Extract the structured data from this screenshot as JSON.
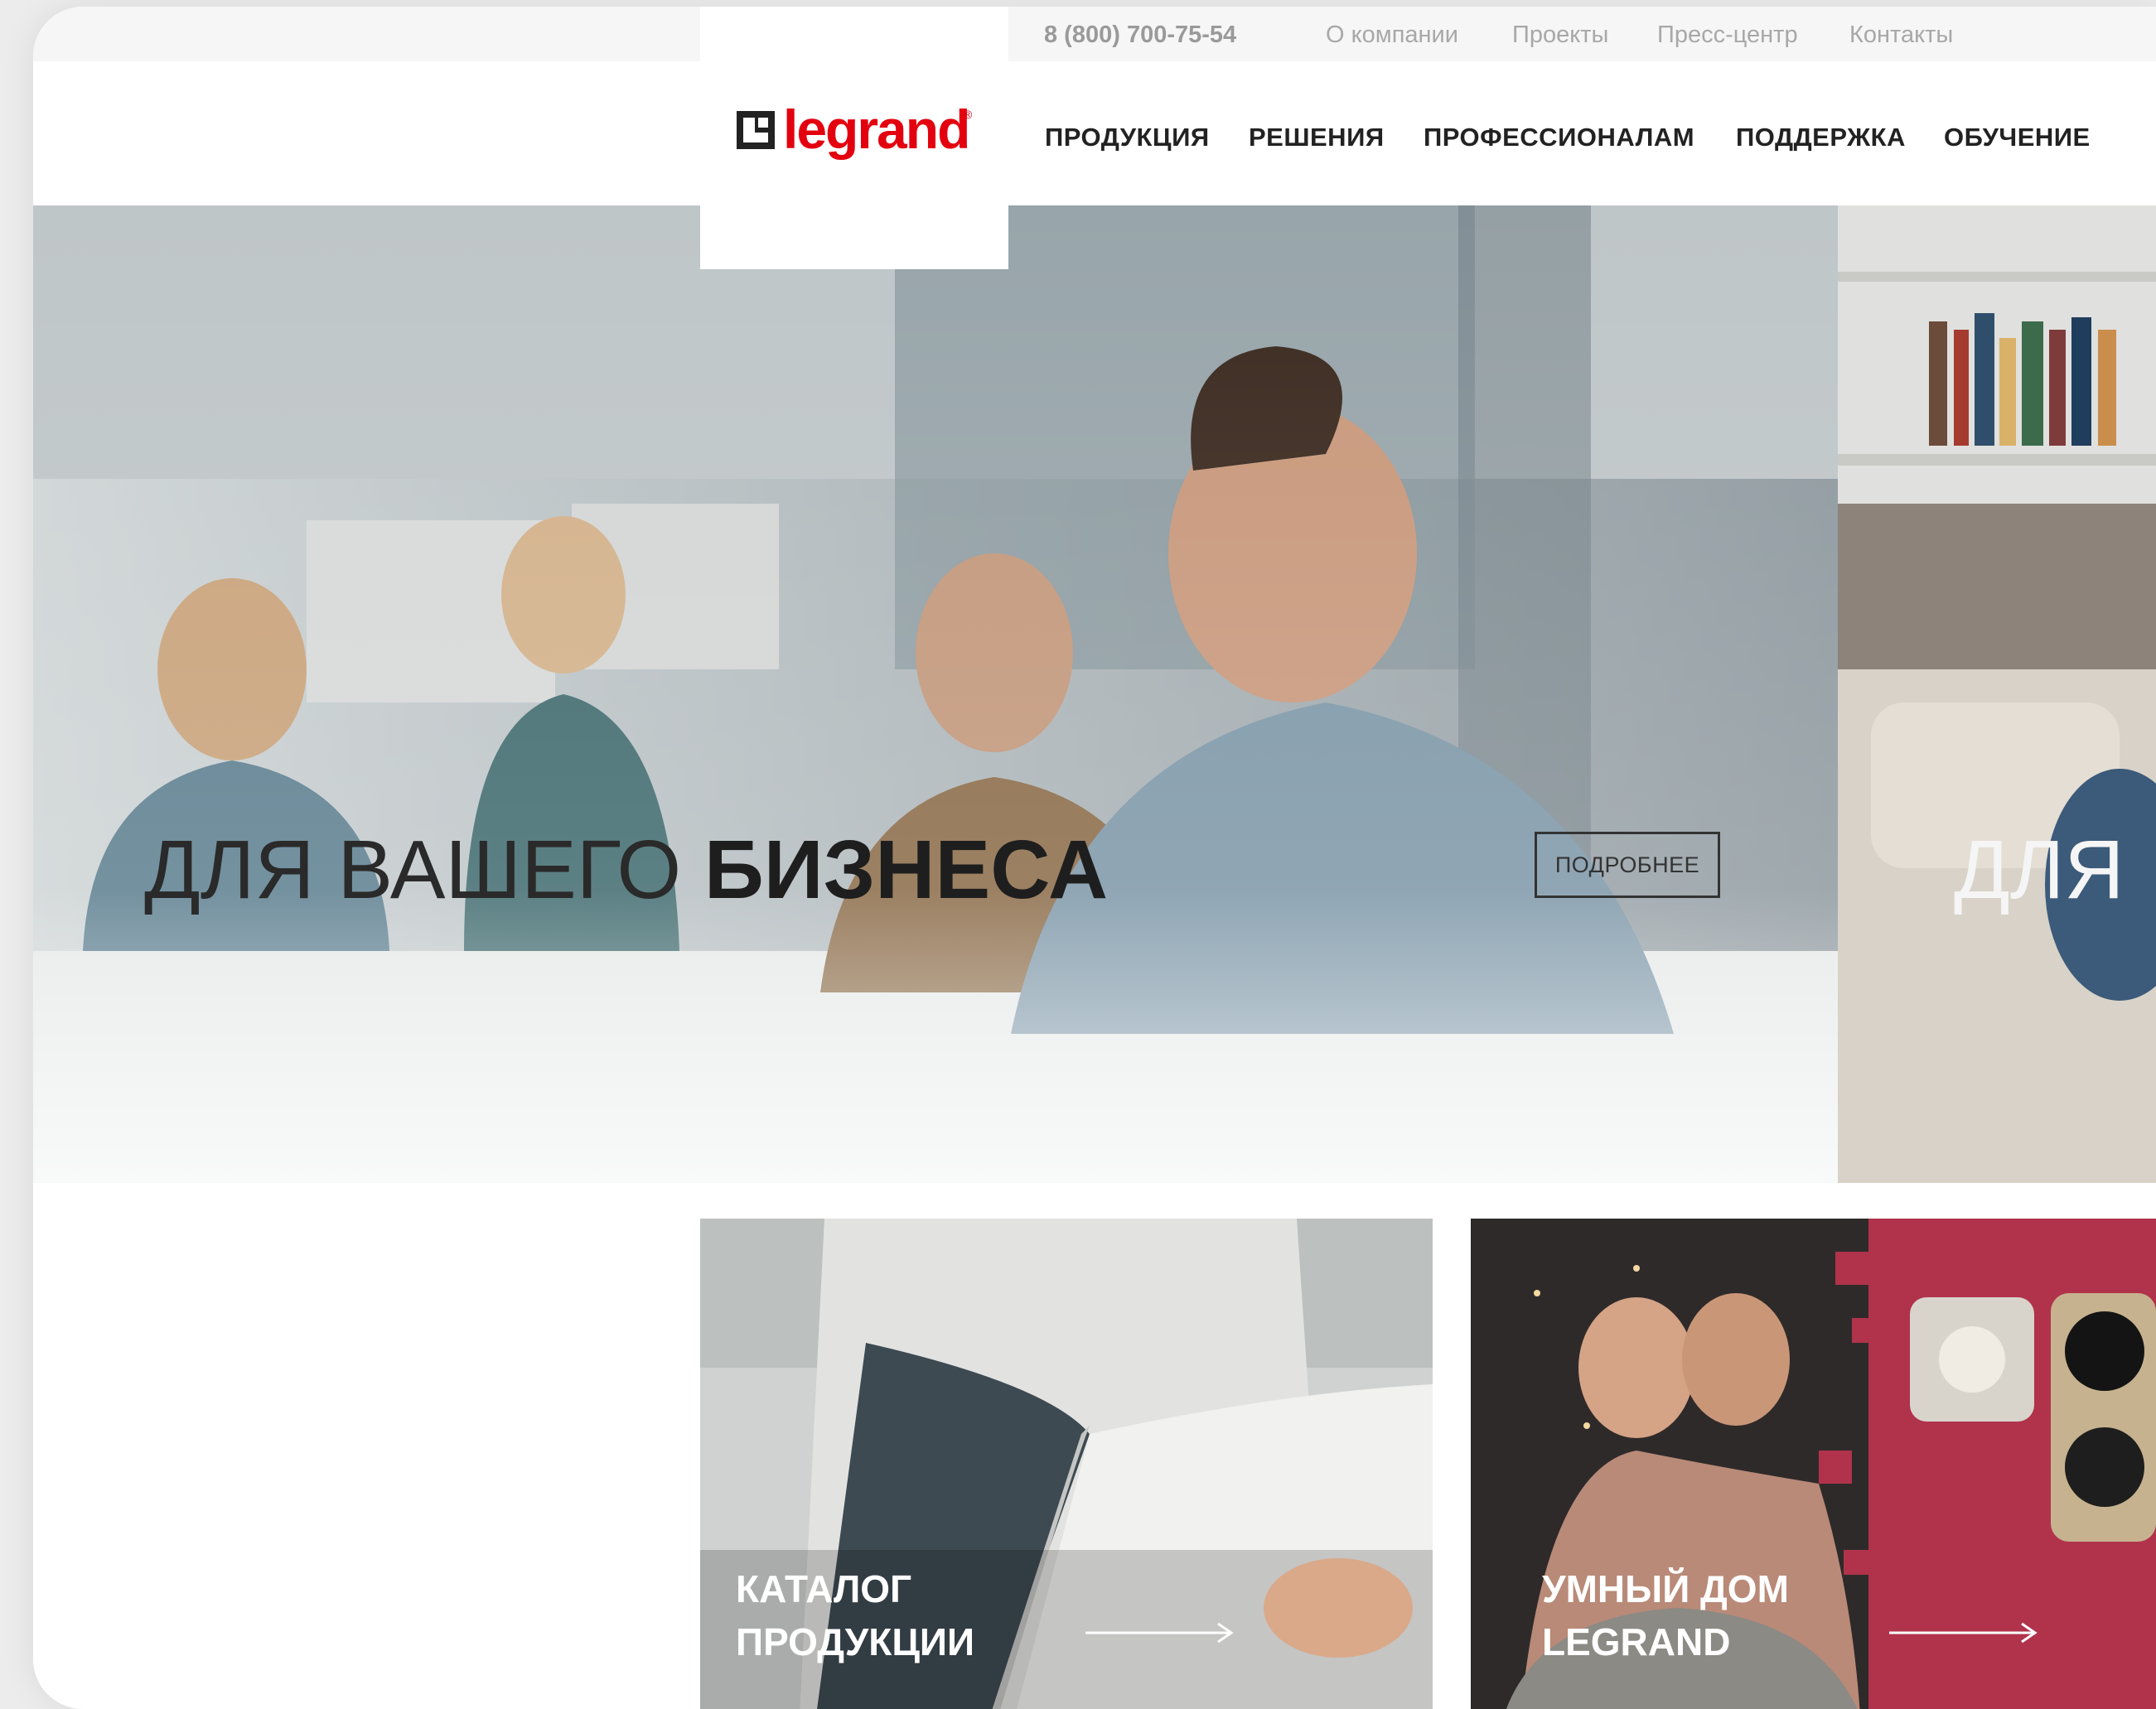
{
  "topbar": {
    "phone": "8 (800) 700-75-54",
    "links": [
      "О компании",
      "Проекты",
      "Пресс-центр",
      "Контакты"
    ]
  },
  "brand": {
    "name": "legrand",
    "color": "#e3000f"
  },
  "nav": [
    "ПРОДУКЦИЯ",
    "РЕШЕНИЯ",
    "ПРОФЕССИОНАЛАМ",
    "ПОДДЕРЖКА",
    "ОБУЧЕНИЕ"
  ],
  "hero": {
    "title_light": "ДЛЯ ВАШЕГО ",
    "title_bold": "БИЗНЕСА",
    "button": "ПОДРОБНЕЕ"
  },
  "hero_next": {
    "title": "ДЛЯ"
  },
  "cards": [
    {
      "title": "КАТАЛОГ\nПРОДУКЦИИ"
    },
    {
      "title": "УМНЫЙ ДОМ\nLEGRAND"
    }
  ]
}
